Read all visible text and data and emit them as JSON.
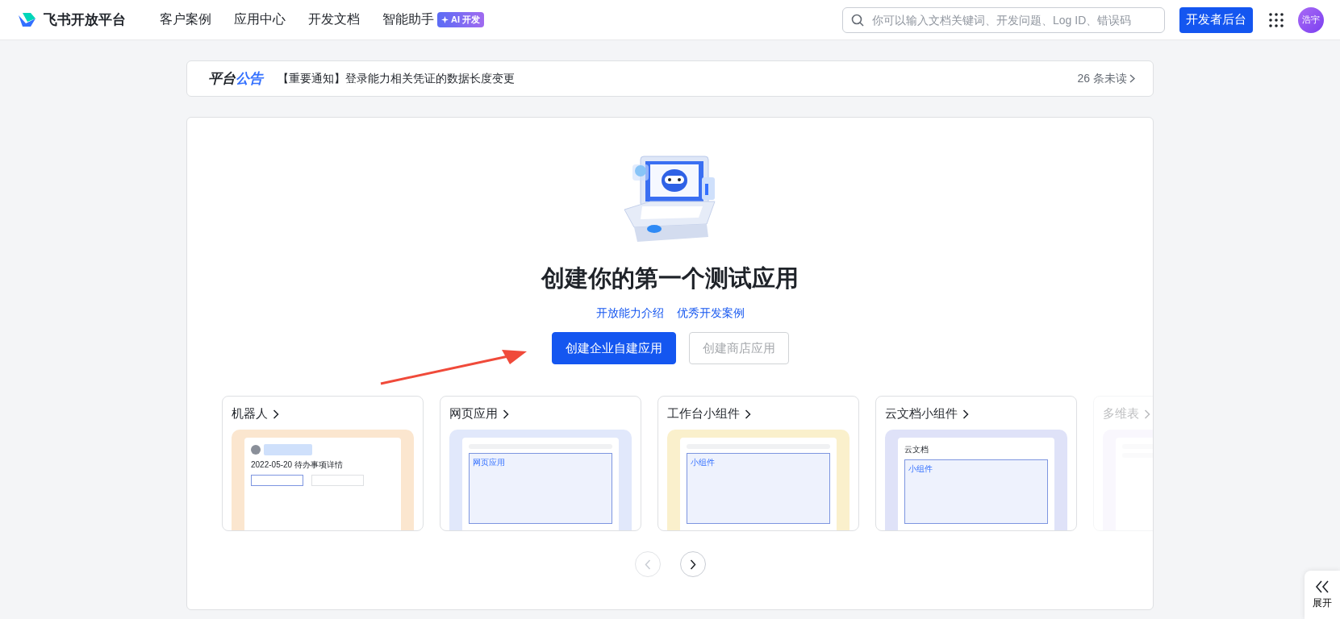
{
  "header": {
    "brand": "飞书开放平台",
    "nav": [
      {
        "label": "客户案例"
      },
      {
        "label": "应用中心"
      },
      {
        "label": "开发文档"
      },
      {
        "label": "智能助手",
        "badge": "AI 开发"
      }
    ],
    "search": {
      "placeholder": "你可以输入文档关键词、开发问题、Log ID、错误码"
    },
    "console_button": "开发者后台",
    "avatar": "浩宇"
  },
  "announcement": {
    "label_main": "平台",
    "label_accent": "公告",
    "text": "【重要通知】登录能力相关凭证的数据长度变更",
    "unread": "26 条未读"
  },
  "hero": {
    "title": "创建你的第一个测试应用",
    "links": [
      "开放能力介绍",
      "优秀开发案例"
    ],
    "buttons": [
      {
        "label": "创建企业自建应用",
        "kind": "primary"
      },
      {
        "label": "创建商店应用",
        "kind": "secondary"
      }
    ]
  },
  "cards": [
    {
      "title": "机器人",
      "kind": "robot",
      "faded": false,
      "texts": [
        "2022-05-20 待办事项详情"
      ]
    },
    {
      "title": "网页应用",
      "kind": "web",
      "faded": false,
      "texts": [
        "网页应用"
      ]
    },
    {
      "title": "工作台小组件",
      "kind": "workbench",
      "faded": false,
      "texts": [
        "小组件"
      ]
    },
    {
      "title": "云文档小组件",
      "kind": "doc",
      "faded": false,
      "texts": [
        "云文档",
        "小组件"
      ]
    },
    {
      "title": "多维表",
      "kind": "base",
      "faded": true
    }
  ],
  "pager": [
    {
      "disabled": true
    },
    {
      "disabled": false
    }
  ],
  "side_tab": {
    "label": "展开"
  }
}
